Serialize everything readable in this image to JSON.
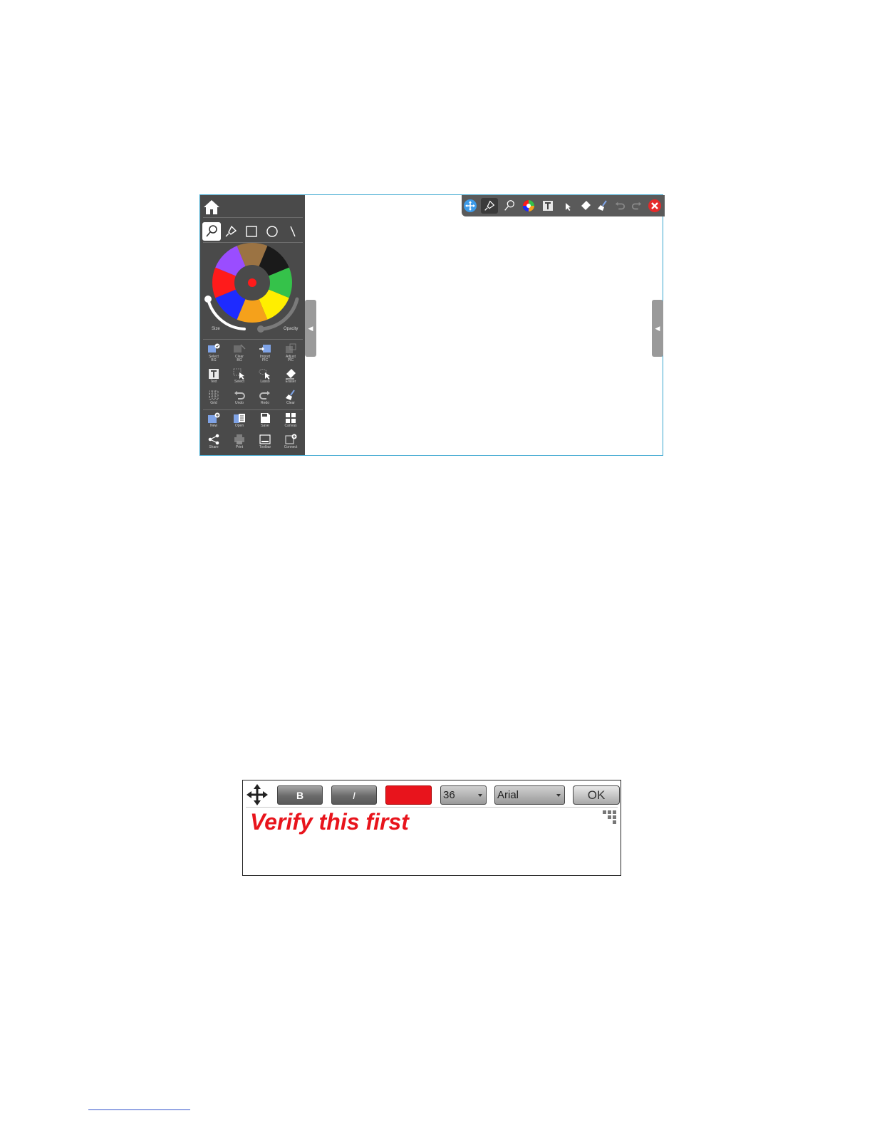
{
  "colors": {
    "sidebar_bg": "#4a4a4a",
    "accent_border": "#3aa6cf",
    "text_color_selected": "#e8141c"
  },
  "whiteboard": {
    "sidebar": {
      "home_icon": "home-icon",
      "shape_tools": [
        "pen-icon",
        "highlighter-icon",
        "rectangle-icon",
        "circle-icon",
        "line-icon"
      ],
      "wheel_colors": [
        "#9b7343",
        "#1a1a1a",
        "#35c24a",
        "#ffee00",
        "#f5a11b",
        "#1e2bff",
        "#ff1b1b",
        "#9a4dff"
      ],
      "wheel_center_color": "#ff1b1b",
      "size_label": "Size",
      "opacity_label": "Opacity",
      "tools_row1": [
        {
          "label1": "Select",
          "label2": "BG"
        },
        {
          "label1": "Clear",
          "label2": "BG"
        },
        {
          "label1": "Import",
          "label2": "PIC"
        },
        {
          "label1": "Adjust",
          "label2": "PIC"
        }
      ],
      "tools_row2": [
        "Text",
        "Select",
        "Lasso",
        "Eraser"
      ],
      "tools_row3": [
        "Grid",
        "Undo",
        "Redo",
        "Clear"
      ],
      "tools_row4": [
        "New",
        "Open",
        "Save",
        "Canvas"
      ],
      "tools_row5": [
        "Share",
        "Print",
        "Toolbar",
        "Connect"
      ]
    },
    "toolbar_icons": [
      "move-icon",
      "pen-icon",
      "highlighter-icon",
      "color-wheel-icon",
      "text-icon",
      "select-icon",
      "eraser-icon",
      "clear-icon",
      "undo-icon",
      "redo-icon",
      "close-icon"
    ]
  },
  "text_dialog": {
    "bold_label": "B",
    "italic_label": "I",
    "color_swatch": "#e8141c",
    "font_size": "36",
    "font_name": "Arial",
    "ok_label": "OK",
    "text": "Verify this first"
  }
}
